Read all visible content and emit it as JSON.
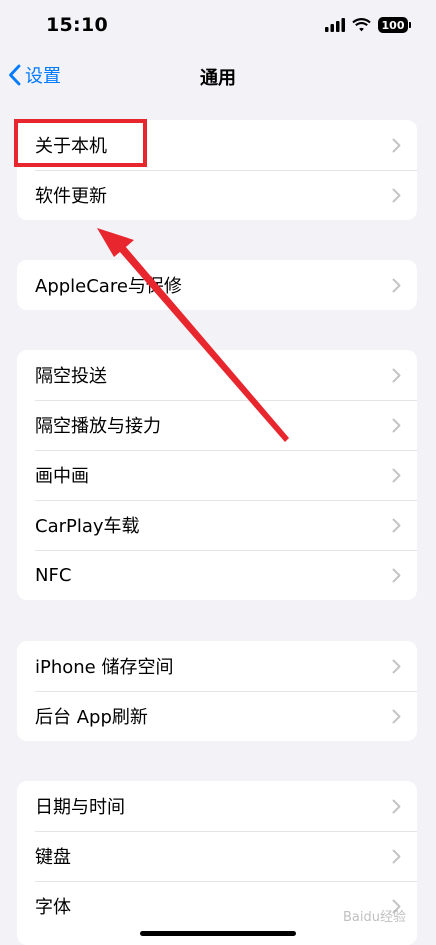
{
  "status_bar": {
    "time": "15:10",
    "battery": "100"
  },
  "nav": {
    "back_label": "设置",
    "title": "通用"
  },
  "groups": [
    {
      "items": [
        {
          "label": "关于本机"
        },
        {
          "label": "软件更新"
        }
      ]
    },
    {
      "items": [
        {
          "label": "AppleCare与保修"
        }
      ]
    },
    {
      "items": [
        {
          "label": "隔空投送"
        },
        {
          "label": "隔空播放与接力"
        },
        {
          "label": "画中画"
        },
        {
          "label": "CarPlay车载"
        },
        {
          "label": "NFC"
        }
      ]
    },
    {
      "items": [
        {
          "label": "iPhone 储存空间"
        },
        {
          "label": "后台 App刷新"
        }
      ]
    },
    {
      "items": [
        {
          "label": "日期与时间"
        },
        {
          "label": "键盘"
        },
        {
          "label": "字体"
        }
      ]
    }
  ],
  "annotation": {
    "highlight_color": "#e8262d"
  },
  "watermark": "Baidu经验"
}
